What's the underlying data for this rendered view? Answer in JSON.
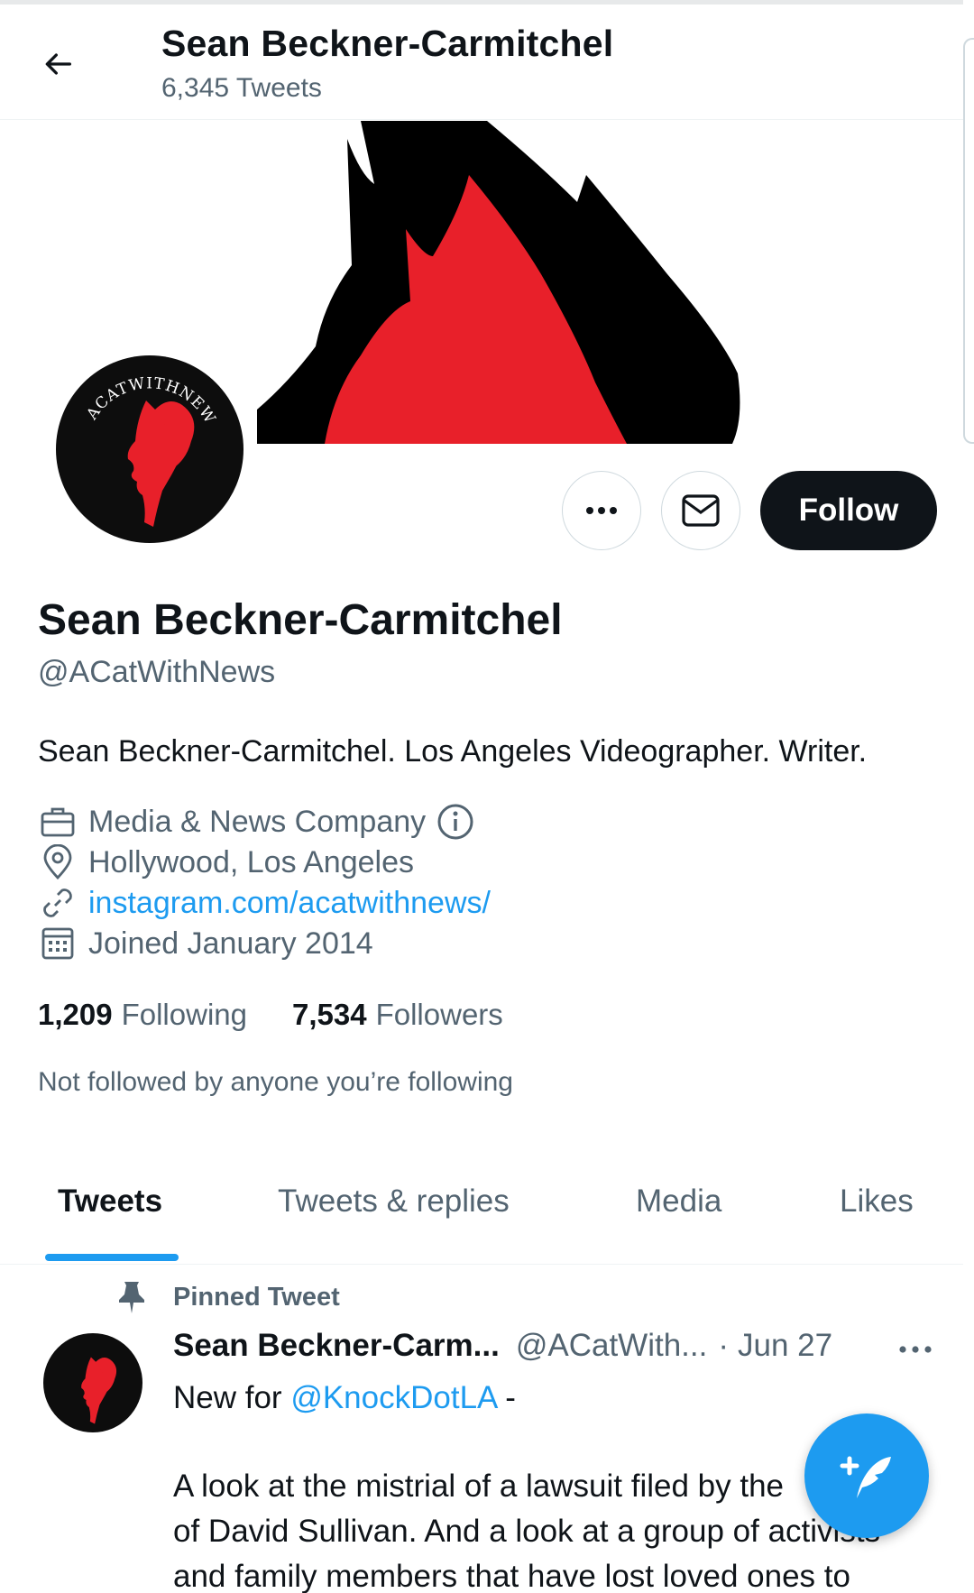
{
  "header": {
    "title": "Sean Beckner-Carmitchel",
    "tweet_count": "6,345 Tweets"
  },
  "avatar": {
    "logo_text": "ACATWITHNEWS"
  },
  "actions": {
    "follow_label": "Follow"
  },
  "profile": {
    "name": "Sean Beckner-Carmitchel",
    "handle": "@ACatWithNews",
    "bio": "Sean Beckner-Carmitchel. Los Angeles Videographer. Writer.",
    "category": "Media & News Company",
    "location": "Hollywood, Los Angeles",
    "website": "instagram.com/acatwithnews/",
    "joined": "Joined January 2014",
    "following_count": "1,209",
    "following_label": "Following",
    "followers_count": "7,534",
    "followers_label": "Followers",
    "not_followed_text": "Not followed by anyone you’re following"
  },
  "tabs": [
    {
      "label": "Tweets",
      "active": true
    },
    {
      "label": "Tweets & replies",
      "active": false
    },
    {
      "label": "Media",
      "active": false
    },
    {
      "label": "Likes",
      "active": false
    }
  ],
  "pinned_tweet": {
    "pinned_label": "Pinned Tweet",
    "author_name": "Sean Beckner-Carm...",
    "author_handle": "@ACatWith...",
    "separator": "·",
    "date": "Jun 27",
    "line1_prefix": "New for ",
    "line1_mention": "@KnockDotLA",
    "line1_suffix": " -",
    "line2": "A look at the mistrial of a lawsuit filed by the",
    "line3": "of David Sullivan. And a look at a group of activists",
    "line4": "and family members that have lost loved ones to"
  },
  "colors": {
    "accent": "#1d9bf0",
    "text_primary": "#0f1419",
    "text_secondary": "#536471",
    "banner_red": "#e8202a",
    "banner_black": "#000000"
  },
  "icons": [
    "back-arrow-icon",
    "more-icon",
    "mail-icon",
    "briefcase-icon",
    "info-icon",
    "location-icon",
    "link-icon",
    "calendar-icon",
    "pin-icon",
    "compose-tweet-icon"
  ]
}
